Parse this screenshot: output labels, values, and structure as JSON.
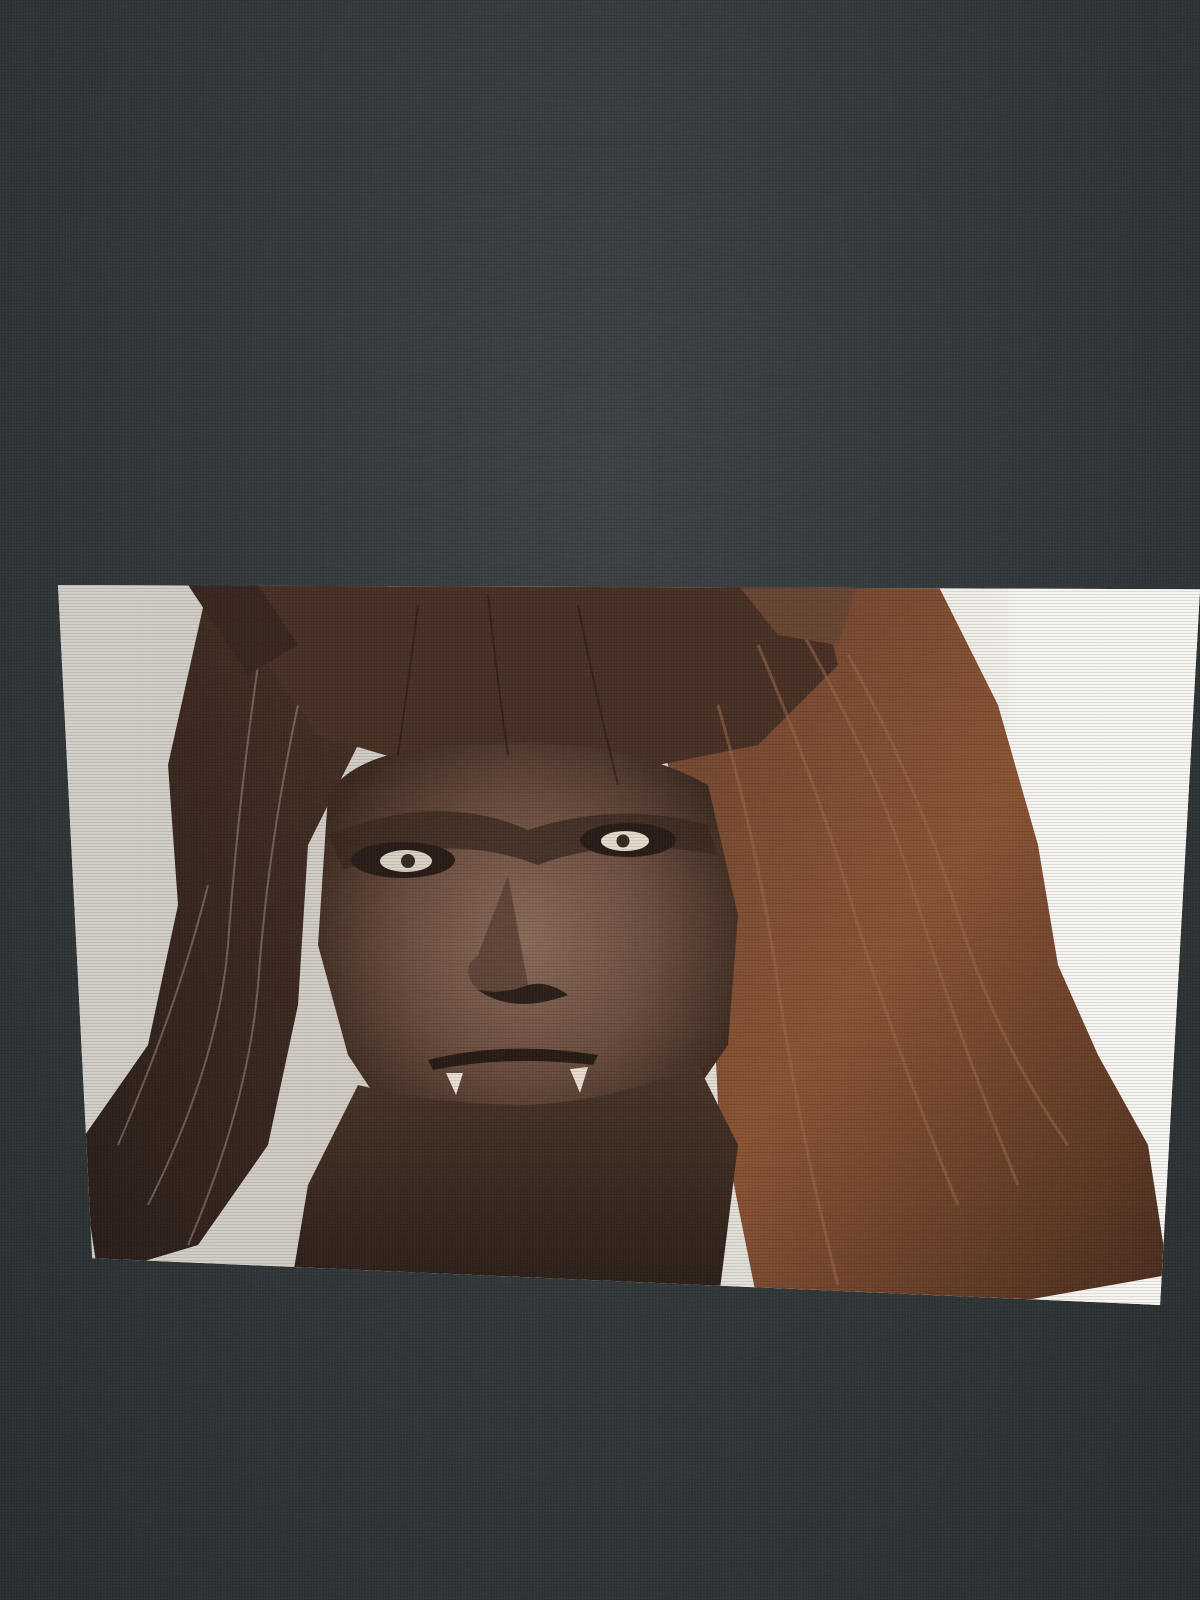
{
  "photo": {
    "subject": "beast-portrait",
    "colors": {
      "screen_background": "#343a3c",
      "photo_background_left": "#d9d6cf",
      "photo_background_right": "#f6f3ee",
      "fur_dark": "#2b1f19",
      "fur_mid": "#5b3a28",
      "fur_light": "#8e5a3a",
      "skin": "#6e5446",
      "eye": "#d8d2c4"
    }
  }
}
